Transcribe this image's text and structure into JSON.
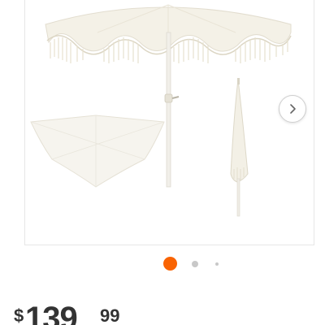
{
  "gallery": {
    "image_description_icon": "umbrella-product-image",
    "next_icon": "chevron-right-icon",
    "slide_count": 3,
    "active_slide": 1
  },
  "price": {
    "currency": "$",
    "dollars": "139",
    "cents": "99"
  },
  "colors": {
    "accent": "#f96302",
    "inactive_dot": "#c8c8c8",
    "price_text": "#333333"
  }
}
